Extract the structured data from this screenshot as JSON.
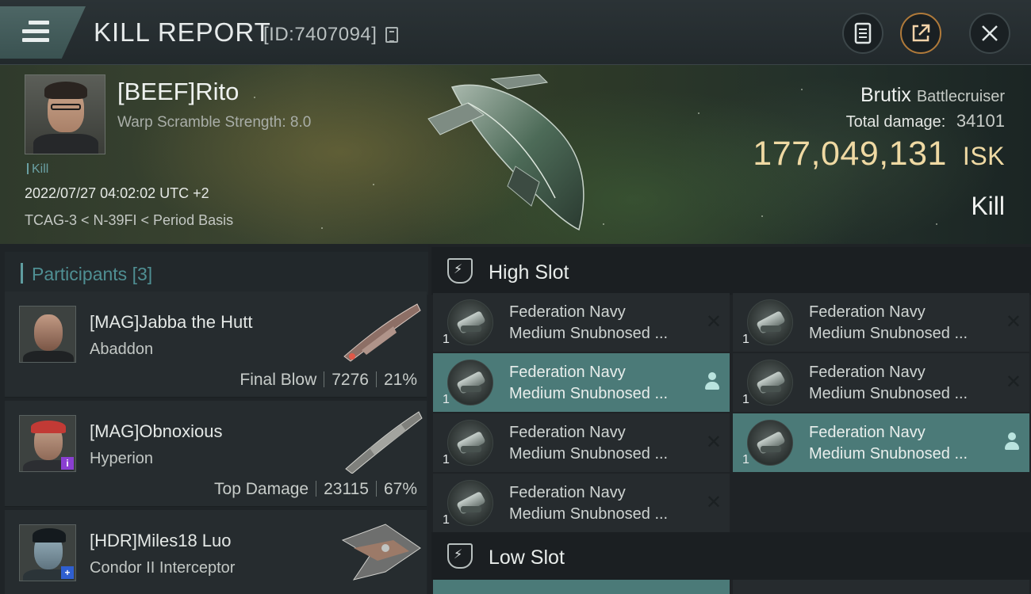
{
  "header": {
    "title": "KILL REPORT",
    "report_id": "[ID:7407094]",
    "menu_icon": "hamburger-menu-icon",
    "buttons": {
      "notes_icon": "notes-icon",
      "share_icon": "share-icon",
      "close_icon": "close-icon"
    }
  },
  "victim": {
    "name": "[BEEF]Rito",
    "warp_scramble": "Warp Scramble Strength: 8.0",
    "tag": "Kill",
    "datetime": "2022/07/27 04:02:02 UTC +2",
    "location": "TCAG-3 < N-39FI < Period Basis",
    "ship_name": "Brutix",
    "ship_class": "Battlecruiser",
    "total_damage_label": "Total damage:",
    "total_damage": "34101",
    "isk_value": "177,049,131",
    "isk_unit": "ISK",
    "result": "Kill"
  },
  "participants": {
    "title": "Participants",
    "count": "[3]",
    "list": [
      {
        "name": "[MAG]Jabba the Hutt",
        "ship": "Abaddon",
        "role": "Final Blow",
        "damage": "7276",
        "percent": "21%",
        "badge": ""
      },
      {
        "name": "[MAG]Obnoxious",
        "ship": "Hyperion",
        "role": "Top Damage",
        "damage": "23115",
        "percent": "67%",
        "badge": "i"
      },
      {
        "name": "[HDR]Miles18 Luo",
        "ship": "Condor II Interceptor",
        "role": "",
        "damage": "",
        "percent": "",
        "badge": "+"
      }
    ]
  },
  "slots": {
    "high_title": "High Slot",
    "low_title": "Low Slot",
    "items": [
      {
        "line1": "Federation Navy",
        "line2": "Medium Snubnosed ...",
        "qty": "1",
        "state": "destroyed"
      },
      {
        "line1": "Federation Navy",
        "line2": "Medium Snubnosed ...",
        "qty": "1",
        "state": "destroyed"
      },
      {
        "line1": "Federation Navy",
        "line2": "Medium Snubnosed ...",
        "qty": "1",
        "state": "dropped"
      },
      {
        "line1": "Federation Navy",
        "line2": "Medium Snubnosed ...",
        "qty": "1",
        "state": "destroyed"
      },
      {
        "line1": "Federation Navy",
        "line2": "Medium Snubnosed ...",
        "qty": "1",
        "state": "destroyed"
      },
      {
        "line1": "Federation Navy",
        "line2": "Medium Snubnosed ...",
        "qty": "1",
        "state": "dropped"
      },
      {
        "line1": "Federation Navy",
        "line2": "Medium Snubnosed ...",
        "qty": "1",
        "state": "destroyed"
      }
    ]
  },
  "colors": {
    "accent": "#4f8f93",
    "isk": "#efd9a3",
    "active_slot": "#4b7a78"
  }
}
